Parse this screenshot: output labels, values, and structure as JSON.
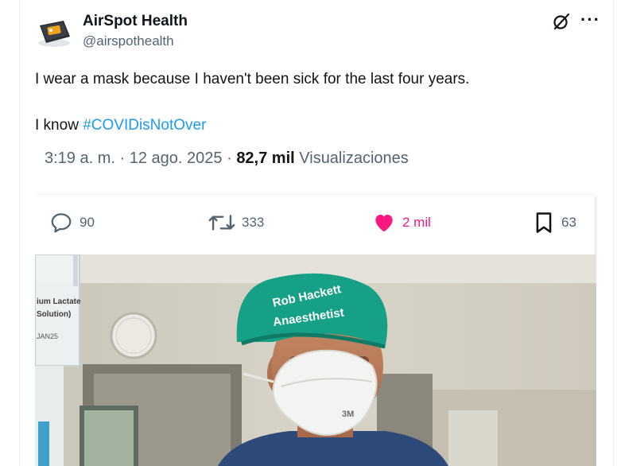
{
  "account": {
    "display_name": "AirSpot Health",
    "handle": "@airspothealth"
  },
  "post": {
    "line1": "I wear a mask because I haven't been sick for the last four years.",
    "line2_prefix": "I know ",
    "hashtag": "#COVIDisNotOver",
    "time": "3:19 a. m.",
    "separator": "·",
    "date": "12 ago. 2025",
    "views_count": "82,7 mil",
    "views_label": "Visualizaciones"
  },
  "actions": {
    "replies": "90",
    "reposts": "333",
    "likes": "2 mil",
    "bookmarks": "63"
  },
  "photo": {
    "cap_line1": "Rob Hackett",
    "cap_line2": "Anaesthetist",
    "iv_line1": "ium Lactate",
    "iv_line2": "Solution)",
    "iv_line3": "JAN25",
    "mask_brand": "3M"
  },
  "colors": {
    "accent": "#1d9bf0",
    "like": "#f91880",
    "muted": "#536471",
    "cap": "#16a085"
  },
  "icons": [
    "grok-icon",
    "more-icon",
    "reply-icon",
    "repost-icon",
    "heart-icon",
    "bookmark-icon"
  ]
}
